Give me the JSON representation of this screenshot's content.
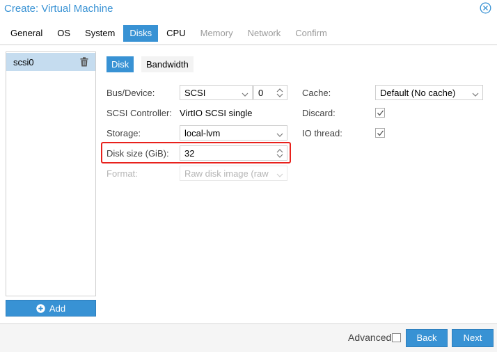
{
  "window": {
    "title": "Create: Virtual Machine",
    "close_icon": "close-circle-icon"
  },
  "tabs": [
    {
      "label": "General",
      "state": "normal"
    },
    {
      "label": "OS",
      "state": "normal"
    },
    {
      "label": "System",
      "state": "normal"
    },
    {
      "label": "Disks",
      "state": "active"
    },
    {
      "label": "CPU",
      "state": "normal"
    },
    {
      "label": "Memory",
      "state": "disabled"
    },
    {
      "label": "Network",
      "state": "disabled"
    },
    {
      "label": "Confirm",
      "state": "disabled"
    }
  ],
  "disk_list": {
    "items": [
      {
        "label": "scsi0",
        "icon": "trash-icon"
      }
    ],
    "add_label": "Add",
    "add_icon": "plus-circle-icon"
  },
  "inner_tabs": [
    {
      "label": "Disk",
      "active": true
    },
    {
      "label": "Bandwidth",
      "active": false
    }
  ],
  "form": {
    "bus_device": {
      "label": "Bus/Device:",
      "bus": "SCSI",
      "device": "0"
    },
    "scsi_controller": {
      "label": "SCSI Controller:",
      "value": "VirtIO SCSI single"
    },
    "storage": {
      "label": "Storage:",
      "value": "local-lvm"
    },
    "disk_size": {
      "label": "Disk size (GiB):",
      "value": "32"
    },
    "format": {
      "label": "Format:",
      "value": "Raw disk image (raw"
    },
    "cache": {
      "label": "Cache:",
      "value": "Default (No cache)"
    },
    "discard": {
      "label": "Discard:",
      "checked": true
    },
    "io_thread": {
      "label": "IO thread:",
      "checked": true
    }
  },
  "footer": {
    "advanced_label": "Advanced",
    "advanced_checked": false,
    "back_label": "Back",
    "next_label": "Next"
  },
  "colors": {
    "accent": "#3892d4",
    "selection": "#c5dcef",
    "highlight": "#e8211c"
  }
}
